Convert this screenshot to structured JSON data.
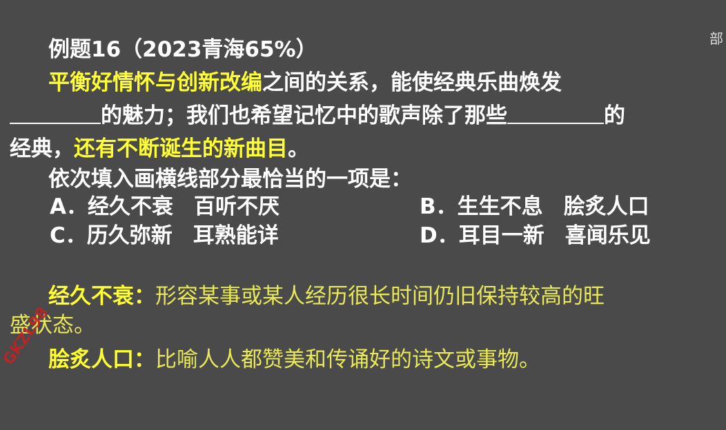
{
  "question": {
    "title": "例题16（2023青海65%）",
    "line1_highlight": "平衡好情怀与创新改编",
    "line1_rest": "之间的关系，能使经典乐曲焕发",
    "line2_a": "的魅力；我们也希望记忆中的歌声除了那些",
    "line2_b": "的",
    "line3_a": "经典，",
    "line3_highlight": "还有不断诞生的新曲目",
    "line3_end": "。",
    "prompt": "依次填入画横线部分最恰当的一项是："
  },
  "options": [
    {
      "label": "A．经久不衰",
      "second": "百听不厌"
    },
    {
      "label": "B．生生不息",
      "second": "脍炙人口"
    },
    {
      "label": "C．历久弥新",
      "second": "耳熟能详"
    },
    {
      "label": "D．耳目一新",
      "second": "喜闻乐见"
    }
  ],
  "definitions": [
    {
      "term": "经久不衰：",
      "text": "形容某事或某人经历很长时间仍旧保持较高的旺",
      "text_cont": "盛状态。"
    },
    {
      "term": "脍炙人口：",
      "text": "比喻人人都赞美和传诵好的诗文或事物。"
    }
  ],
  "watermark": "GKZL98",
  "corner_char": "部",
  "colors": {
    "background": "#4a4a4a",
    "highlight": "#ffff33",
    "text": "#ffffff"
  }
}
